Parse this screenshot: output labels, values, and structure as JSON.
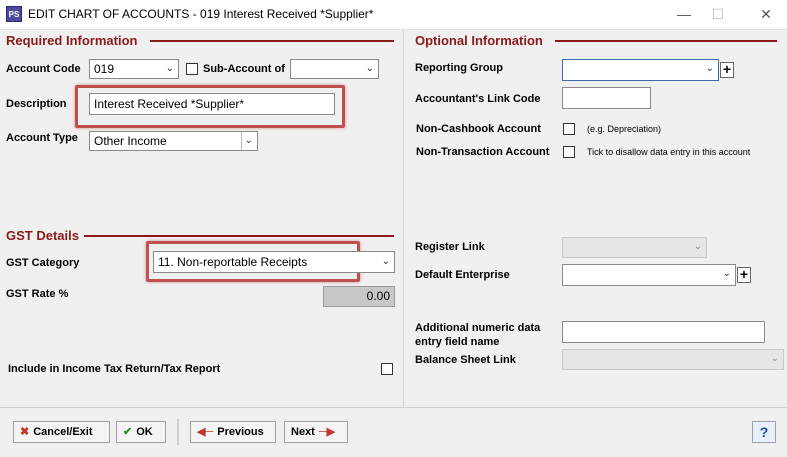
{
  "window": {
    "title": "EDIT CHART OF ACCOUNTS - 019 Interest Received *Supplier*",
    "app_icon": "PS",
    "minimize": "—",
    "maximize": "☐",
    "close": "✕"
  },
  "required": {
    "heading": "Required Information",
    "account_code_label": "Account Code",
    "account_code_value": "019",
    "sub_account_label": "Sub-Account of",
    "sub_account_value": "",
    "description_label": "Description",
    "description_value": "Interest Received *Supplier*",
    "account_type_label": "Account Type",
    "account_type_value": "Other Income"
  },
  "gst": {
    "heading": "GST Details",
    "category_label": "GST Category",
    "category_value": "11. Non-reportable Receipts",
    "rate_label": "GST Rate %",
    "rate_value": "0.00",
    "income_tax_label": "Include in Income Tax Return/Tax Report"
  },
  "optional": {
    "heading": "Optional Information",
    "reporting_group_label": "Reporting Group",
    "reporting_group_value": "",
    "accountant_link_label": "Accountant's Link Code",
    "accountant_link_value": "",
    "non_cashbook_label": "Non-Cashbook Account",
    "non_cashbook_hint": "(e.g. Depreciation)",
    "non_transaction_label": "Non-Transaction Account",
    "non_transaction_hint": "Tick to disallow data entry in this account",
    "register_link_label": "Register Link",
    "default_enterprise_label": "Default Enterprise",
    "additional_field_label_1": "Additional numeric data",
    "additional_field_label_2": "entry field name",
    "balance_sheet_label": "Balance Sheet Link"
  },
  "footer": {
    "cancel_label": "Cancel/Exit",
    "ok_label": "OK",
    "previous_label": "Previous",
    "next_label": "Next",
    "help_label": "?"
  },
  "colors": {
    "section_accent": "#8b1a1a",
    "highlight": "#c0504d"
  }
}
